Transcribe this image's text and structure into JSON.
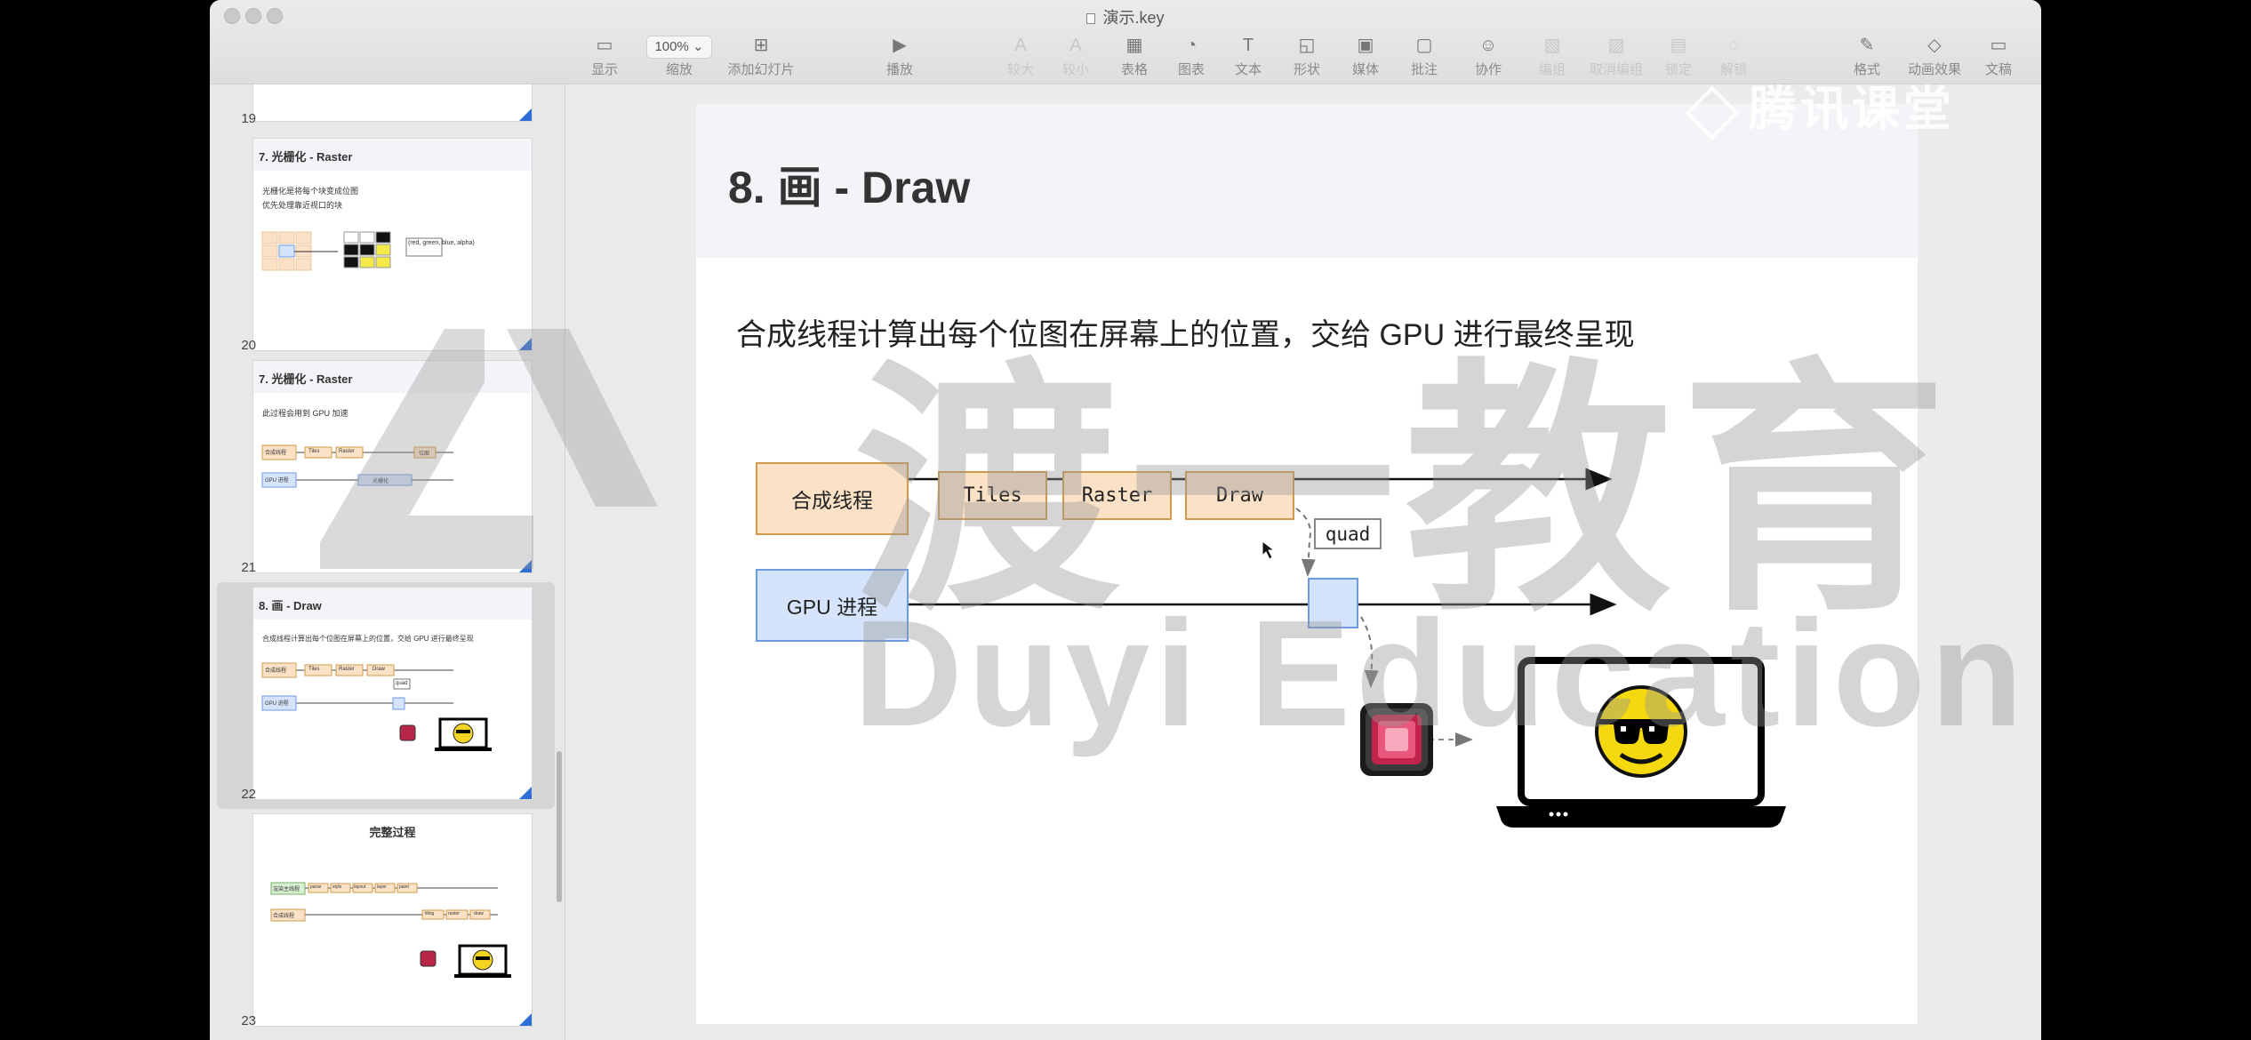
{
  "window": {
    "title": "演示.key"
  },
  "toolbar": {
    "items": [
      {
        "label": "显示",
        "icon": "sidebar-icon"
      },
      {
        "label": "缩放",
        "value": "100%",
        "icon": "zoom-select"
      },
      {
        "label": "添加幻灯片",
        "icon": "add-slide-icon"
      },
      {
        "label": "播放",
        "icon": "play-icon"
      },
      {
        "label": "较大",
        "icon": "font-larger-icon"
      },
      {
        "label": "较小",
        "icon": "font-smaller-icon"
      },
      {
        "label": "表格",
        "icon": "table-icon"
      },
      {
        "label": "图表",
        "icon": "chart-icon"
      },
      {
        "label": "文本",
        "icon": "text-icon"
      },
      {
        "label": "形状",
        "icon": "shape-icon"
      },
      {
        "label": "媒体",
        "icon": "media-icon"
      },
      {
        "label": "批注",
        "icon": "comment-icon"
      },
      {
        "label": "协作",
        "icon": "collaborate-icon"
      },
      {
        "label": "编组",
        "icon": "group-icon"
      },
      {
        "label": "取消编组",
        "icon": "ungroup-icon"
      },
      {
        "label": "锁定",
        "icon": "lock-icon"
      },
      {
        "label": "解锁",
        "icon": "unlock-icon"
      },
      {
        "label": "格式",
        "icon": "format-icon"
      },
      {
        "label": "动画效果",
        "icon": "animate-icon"
      },
      {
        "label": "文稿",
        "icon": "document-icon"
      }
    ]
  },
  "sidebar": {
    "slides": [
      {
        "number": "19"
      },
      {
        "number": "20",
        "title": "7. 光栅化 - Raster",
        "lines": [
          "光栅化是将每个块变成位图",
          "优先处理靠近视口的块"
        ],
        "label": "(red, green, blue, alpha)"
      },
      {
        "number": "21",
        "title": "7. 光栅化 - Raster",
        "lines": [
          "此过程会用到 GPU 加速"
        ],
        "labels": [
          "合成线程",
          "Tiles",
          "Raster",
          "位图",
          "GPU 进程",
          "光栅化"
        ]
      },
      {
        "number": "22",
        "title": "8. 画 - Draw",
        "lines": [
          "合成线程计算出每个位图在屏幕上的位置，交给 GPU 进行最终呈现"
        ],
        "labels": [
          "合成线程",
          "Tiles",
          "Raster",
          "Draw",
          "GPU 进程",
          "quad"
        ]
      },
      {
        "number": "23",
        "title": "完整过程",
        "labels": [
          "渲染主线程",
          "parse",
          "style",
          "layout",
          "layer",
          "paint",
          "合成线程",
          "tiling",
          "raster",
          "draw"
        ]
      }
    ]
  },
  "slide": {
    "title": "8. 画 - Draw",
    "subtitle": "合成线程计算出每个位图在屏幕上的位置，交给 GPU 进行最终呈现",
    "compositor_label": "合成线程",
    "steps": [
      "Tiles",
      "Raster",
      "Draw"
    ],
    "quad_label": "quad",
    "gpu_label": "GPU  进程"
  },
  "watermark": {
    "cn": "渡一教育",
    "en": "Duyi Education",
    "brand": "腾讯课堂"
  },
  "colors": {
    "orange_fill": "#fbe2c6",
    "orange_border": "#d19a4b",
    "blue_fill": "#d6e4fb",
    "blue_border": "#6e9be0",
    "selection_corner": "#2d6fd6"
  }
}
